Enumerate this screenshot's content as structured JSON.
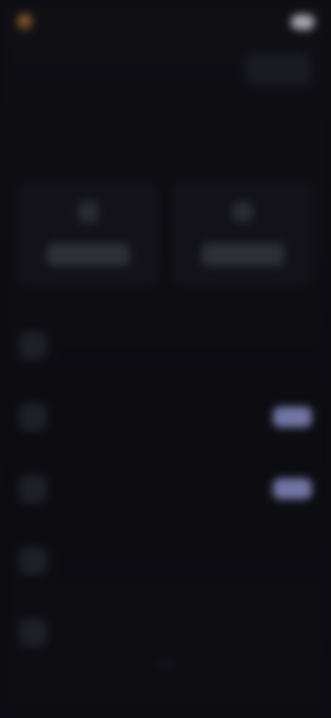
{
  "header": {
    "brand_name": "",
    "link_label": "",
    "accent": "#9b6a2e"
  },
  "subtitle": {
    "text": ""
  },
  "section_label": "",
  "tiles": [
    {
      "icon": "app-icon",
      "button_label": ""
    },
    {
      "icon": "app-icon",
      "button_label": ""
    }
  ],
  "rows": [
    {
      "icon": "item-icon",
      "title": "",
      "description": "",
      "has_badge": false
    },
    {
      "icon": "item-icon",
      "title": "",
      "description": "",
      "has_badge": true
    },
    {
      "icon": "item-icon",
      "title": "",
      "description": "",
      "has_badge": true
    },
    {
      "icon": "item-icon",
      "title": "",
      "description": "",
      "has_badge": false
    },
    {
      "icon": "item-icon",
      "title": "",
      "description": "",
      "has_badge": false
    }
  ],
  "footer": {
    "label": ""
  },
  "colors": {
    "background": "#0d0d12",
    "badge": "#8c90c8"
  }
}
